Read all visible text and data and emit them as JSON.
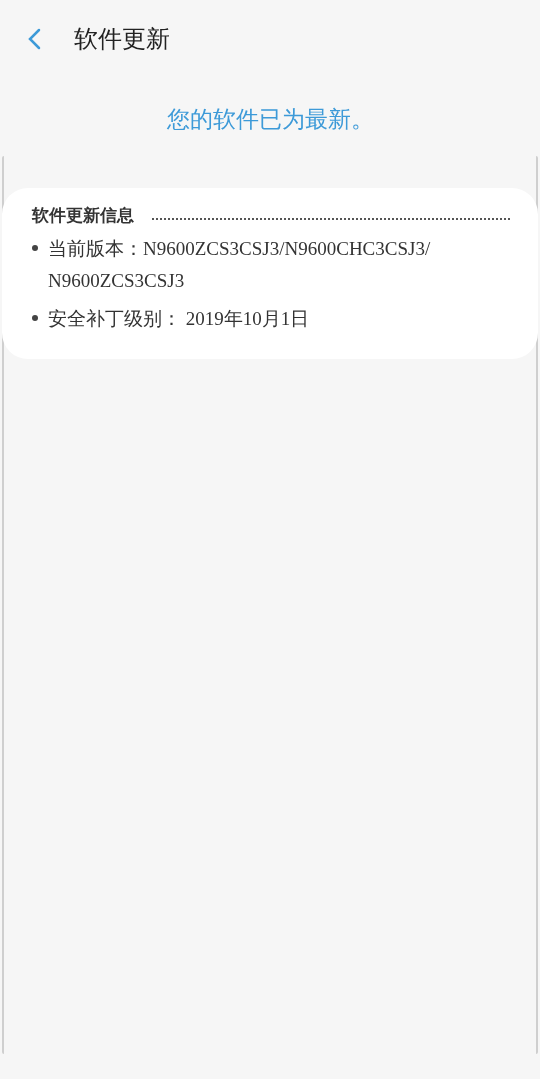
{
  "header": {
    "title": "软件更新"
  },
  "status_message": "您的软件已为最新。",
  "info_card": {
    "title": "软件更新信息",
    "items": [
      "当前版本：N9600ZCS3CSJ3/N9600CHC3CSJ3/N9600ZCS3CSJ3",
      "安全补丁级别： 2019年10月1日"
    ]
  }
}
